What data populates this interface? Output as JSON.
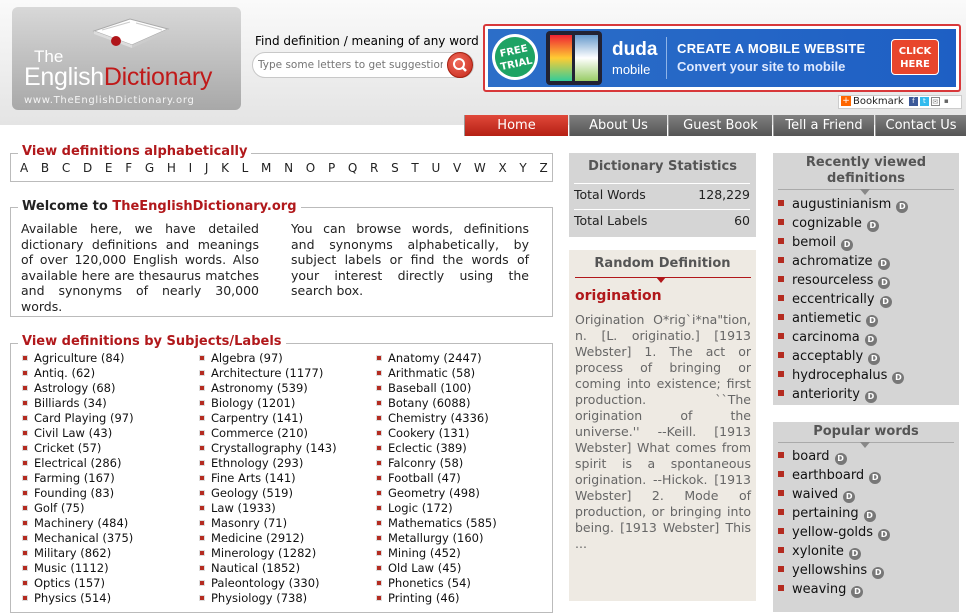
{
  "logo": {
    "the": "The",
    "english": "English",
    "dictionary": "Dictionary",
    "url": "www.TheEnglishDictionary.org"
  },
  "search": {
    "label": "Find definition / meaning of any word",
    "placeholder": "Type some letters to get suggestions"
  },
  "ad": {
    "badge": "FREE TRIAL",
    "brand": "duda",
    "brand_sub": "mobile",
    "line1": "CREATE A MOBILE WEBSITE",
    "line2": "Convert your site to mobile",
    "cta": "CLICK HERE"
  },
  "bookmark": {
    "label": "Bookmark"
  },
  "nav": {
    "tabs": [
      "Home",
      "About Us",
      "Guest Book",
      "Tell a Friend",
      "Contact Us"
    ],
    "active": "Home"
  },
  "alphabet": {
    "title": "View definitions alphabetically",
    "letters": [
      "A",
      "B",
      "C",
      "D",
      "E",
      "F",
      "G",
      "H",
      "I",
      "J",
      "K",
      "L",
      "M",
      "N",
      "O",
      "P",
      "Q",
      "R",
      "S",
      "T",
      "U",
      "V",
      "W",
      "X",
      "Y",
      "Z"
    ]
  },
  "welcome": {
    "title_prefix": "Welcome to ",
    "title_site": "TheEnglishDictionary.org",
    "col1": "Available here, we have detailed dictionary definitions and meanings of over 120,000 English words. Also available here are thesaurus matches and synonyms of nearly 30,000 words.",
    "col2": "You can browse words, definitions and synonyms alphabetically, by subject labels or find the words of your interest directly using the search box."
  },
  "subjects": {
    "title": "View definitions by Subjects/Labels",
    "col1": [
      "Agriculture (84)",
      "Antiq. (62)",
      "Astrology (68)",
      "Billiards (34)",
      "Card Playing (97)",
      "Civil Law (43)",
      "Cricket (57)",
      "Electrical (286)",
      "Farming (167)",
      "Founding (83)",
      "Golf (75)",
      "Machinery (484)",
      "Mechanical (375)",
      "Military (862)",
      "Music (1112)",
      "Optics (157)",
      "Physics (514)"
    ],
    "col2": [
      "Algebra (97)",
      "Architecture (1177)",
      "Astronomy (539)",
      "Biology (1201)",
      "Carpentry (141)",
      "Commerce (210)",
      "Crystallography (143)",
      "Ethnology (293)",
      "Fine Arts (141)",
      "Geology (519)",
      "Law (1933)",
      "Masonry (71)",
      "Medicine (2912)",
      "Minerology (1282)",
      "Nautical (1852)",
      "Paleontology (330)",
      "Physiology (738)"
    ],
    "col3": [
      "Anatomy (2447)",
      "Arithmatic (58)",
      "Baseball (100)",
      "Botany (6088)",
      "Chemistry (4336)",
      "Cookery (131)",
      "Eclectic (389)",
      "Falconry (58)",
      "Football (47)",
      "Geometry (498)",
      "Logic (172)",
      "Mathematics (585)",
      "Metallurgy (160)",
      "Mining (452)",
      "Old Law (45)",
      "Phonetics (54)",
      "Printing (46)"
    ]
  },
  "stats": {
    "title": "Dictionary Statistics",
    "rows": [
      {
        "label": "Total Words",
        "value": "128,229"
      },
      {
        "label": "Total Labels",
        "value": "60"
      }
    ]
  },
  "random": {
    "title": "Random Definition",
    "word": "origination",
    "text": "Origination O*rig`i*na\"tion, n. [L. originatio.] [1913 Webster] 1. The act or process of bringing or coming into existence; first production. ``The origination of the universe.'' --Keill. [1913 Webster] What comes from spirit is a spontaneous origination. --Hickok. [1913 Webster] 2. Mode of production, or bringing into being. [1913 Webster] This ..."
  },
  "recent": {
    "title": "Recently viewed definitions",
    "words": [
      "augustinianism",
      "cognizable",
      "bemoil",
      "achromatize",
      "resourceless",
      "eccentrically",
      "antiemetic",
      "carcinoma",
      "acceptably",
      "hydrocephalus",
      "anteriority"
    ]
  },
  "popular": {
    "title": "Popular words",
    "words": [
      "board",
      "earthboard",
      "waived",
      "pertaining",
      "yellow-golds",
      "xylonite",
      "yellowshins",
      "weaving"
    ]
  }
}
